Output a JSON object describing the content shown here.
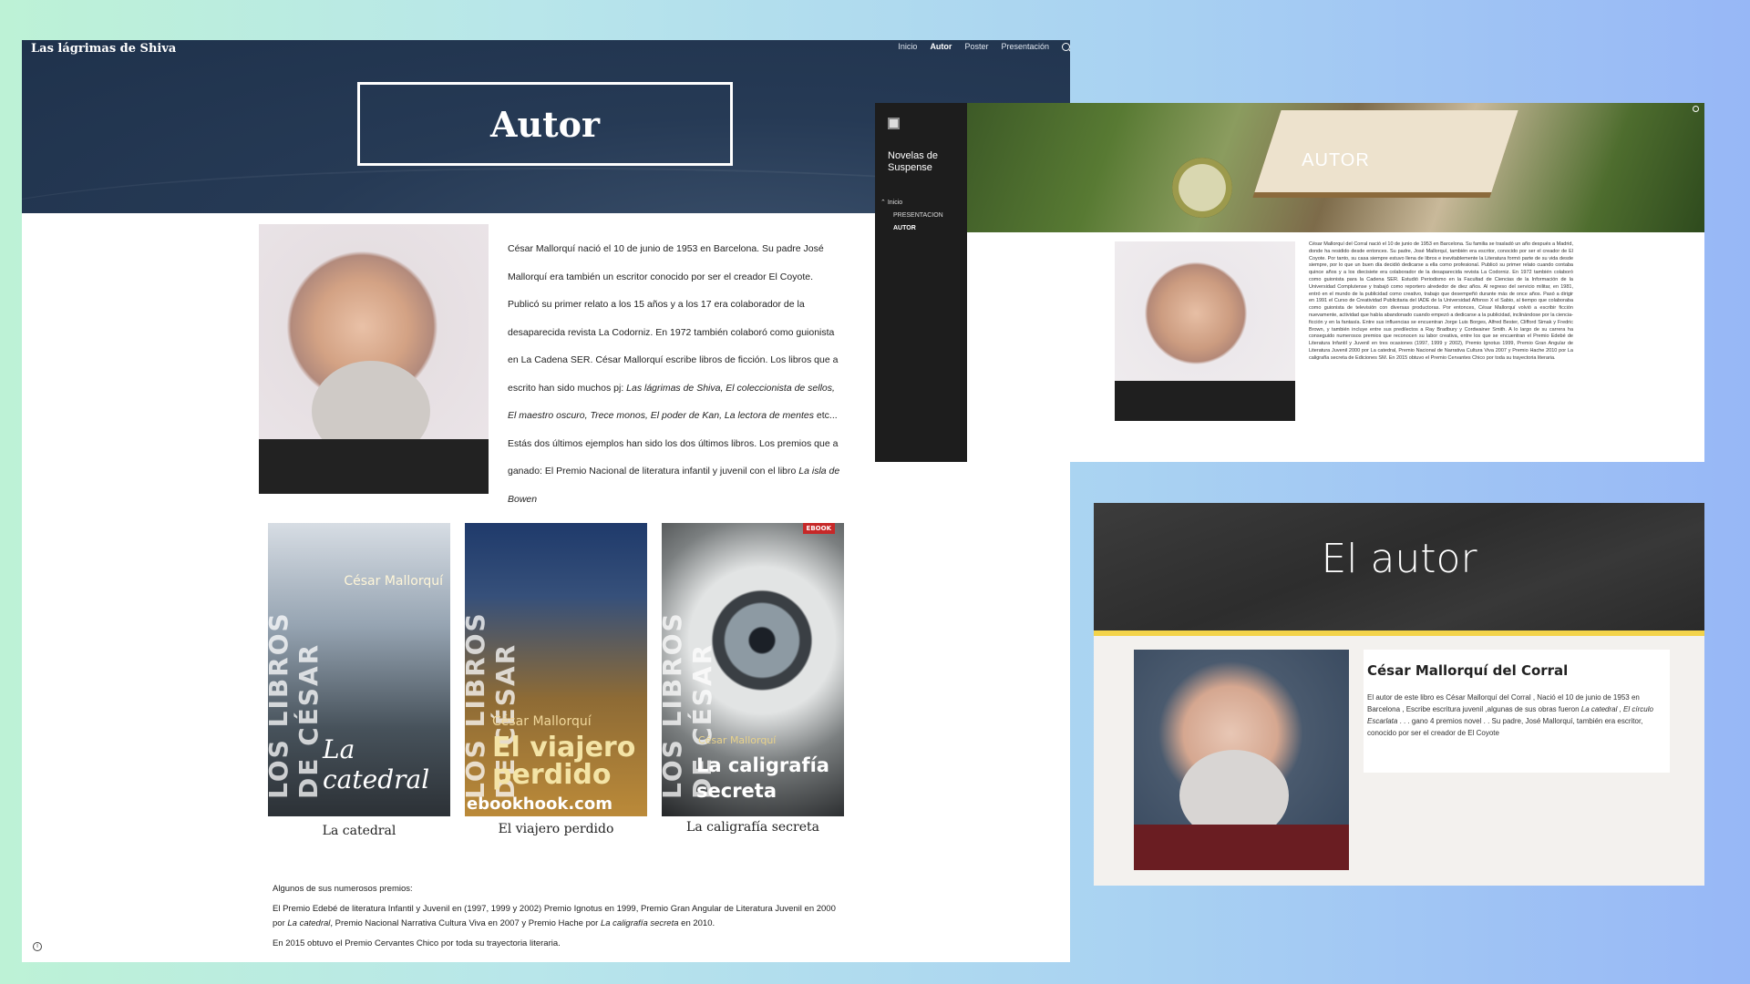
{
  "panel1": {
    "site_title": "Las lágrimas de Shiva",
    "nav": [
      "Inicio",
      "Autor",
      "Poster",
      "Presentación"
    ],
    "nav_active": "Autor",
    "hero_title": "Autor",
    "bio": {
      "p1": "César Mallorquí nació el 10 de junio de 1953 en Barcelona. Su padre José Mallorquí era también un escritor conocido por ser el creador El Coyote. Publicó su primer relato a los 15 años y a los 17 era colaborador de la desaparecida revista La Codorniz. En 1972 también colaboró como guionista en La Cadena  SER. César Mallorquí escribe libros de ficción. Los libros que a escrito han sido muchos pj: ",
      "works_italic": "Las lágrimas de Shiva, El coleccionista de sellos, El maestro oscuro, Trece monos, El poder de Kan, La lectora de mentes",
      "p2": " etc... Estás dos últimos ejemplos han sido los dos últimos libros. Los premios que a ganado: El Premio Nacional de literatura infantil y juvenil con el libro ",
      "award_book": "La isla de Bowen"
    },
    "books": [
      {
        "series": "LOS LIBROS DE CÉSAR",
        "author": "César Mallorquí",
        "cover_title": "La catedral",
        "caption": "La catedral"
      },
      {
        "series": "LOS LIBROS DE CÉSAR",
        "author": "César Mallorquí",
        "cover_title": "El viajero perdido",
        "caption": "El viajero perdido",
        "watermark": "ebookhook.com"
      },
      {
        "series": "LOS LIBROS DE CÉSAR",
        "author": "César Mallorquí",
        "cover_title": "La caligrafía secreta",
        "caption": "La caligrafía secreta",
        "badge": "EBOOK"
      }
    ],
    "awards": {
      "intro": "Algunos de sus numerosos premios:",
      "line1_a": "El Premio Edebé de literatura Infantil y Juvenil en (1997, 1999 y 2002) Premio Ignotus en 1999, Premio Gran Angular de Literatura Juvenil en 2000 por ",
      "line1_b": "La catedral",
      "line1_c": ", Premio Nacional Narrativa Cultura Viva en 2007 y Premio Hache por ",
      "line1_d": "La caligrafía secreta",
      "line1_e": " en 2010.",
      "line2": "En 2015 obtuvo el Premio Cervantes Chico por toda su trayectoria literaria."
    }
  },
  "panel2": {
    "site_name": "Novelas de Suspense",
    "menu": [
      "Inicio",
      "PRESENTACION",
      "AUTOR"
    ],
    "banner_title": "AUTOR",
    "text": "César Mallorquí del Corral nació el 10 de junio de 1953 en Barcelona. Su familia se trasladó un año después a Madrid, donde ha residido desde entonces. Su padre, José Mallorquí, también era escritor, conocido por ser el creador de El Coyote. Por tanto, su casa siempre estuvo llena de libros e inevitablemente la Literatura formó parte de su vida desde siempre, por lo que un buen día decidió dedicarse a ella como profesional. Publicó su primer relato cuando contaba quince años y a los diecisiete era colaborador de la desaparecida revista La Codorniz. En 1972 también colaboró como guionista para la Cadena SER. Estudió Periodismo en la Facultad de Ciencias de la Información de la Universidad Complutense y trabajó como reportero alrededor de diez años. Al regreso del servicio militar, en 1981, entró en el mundo de la publicidad como creativo, trabajo que desempeñó durante más de once años. Pasó a dirigir en 1991 el Curso de Creatividad Publicitaria del IADE de la Universidad Alfonso X el Sabio, al tiempo que colaboraba como guionista de televisión con diversas productoras. Por entonces, César Mallorquí volvió a escribir ficción nuevamente, actividad que había abandonado cuando empezó a dedicarse a la publicidad, inclinándose por la ciencia-ficción y en la fantasía. Entre sus influencias se encuentran Jorge Luis Borges, Alfred Bester, Clifford Simak y Fredric Brown, y también incluye entre sus predilectos a Ray Bradbury y Cordwainer Smith. A lo largo de su carrera ha conseguido numerosos premios que reconocen su labor creativa, entre los que se encuentran el Premio Edebé de Literatura Infantil y Juvenil en tres ocasiones (1997, 1999 y 2002), Premio Ignotus 1999, Premio Gran Angular de Literatura Juvenil 2000 por La catedral, Premio Nacional de Narrativa Cultura Viva 2007 y Premio Hache 2010 por La caligrafía secreta de Ediciones SM. En 2015 obtuvo el Premio Cervantes Chico por toda su trayectoria literaria."
  },
  "panel3": {
    "header_title": "El autor",
    "name": "César Mallorquí del Corral",
    "p_a": "El autor de este libro es César Mallorquí del Corral ,  Nació el 10 de junio de 1953 en Barcelona , Escribe escritura juvenil ,algunas de sus obras fueron  ",
    "works": "La catedral , El círculo Escarlata",
    "p_b": "  . . .  gano 4 premios novel . . Su padre, José Mallorquí, también era escritor, conocido por ser el creador de El Coyote"
  },
  "colors": {
    "p1_hero": "#1f324c",
    "p2_sidebar": "#1d1d1d",
    "p3_accent": "#f3d34a"
  }
}
